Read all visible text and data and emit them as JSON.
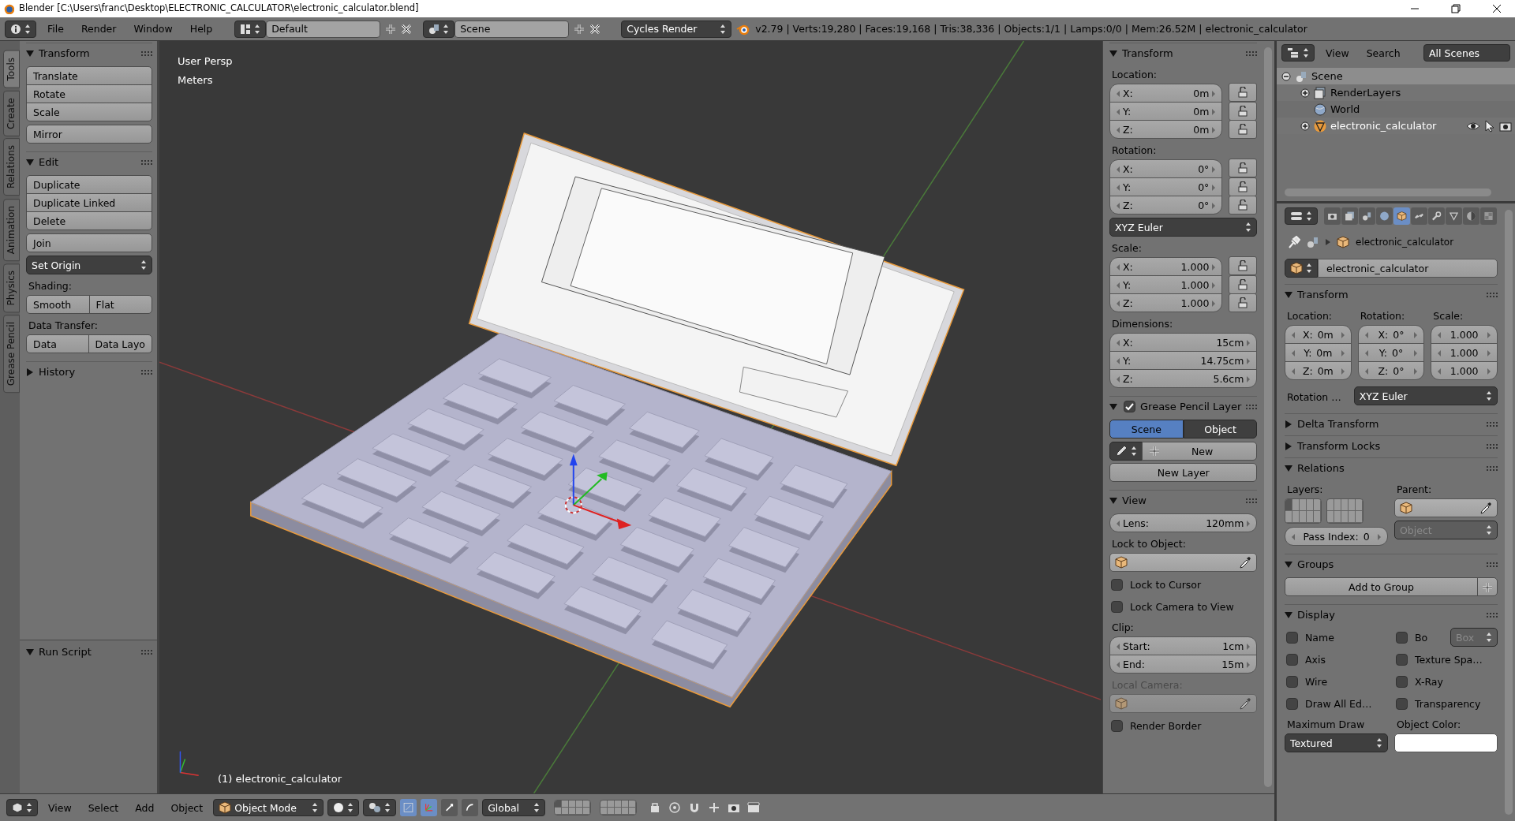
{
  "title_bar": {
    "title": "Blender  [C:\\Users\\franc\\Desktop\\ELECTRONIC_CALCULATOR\\electronic_calculator.blend]"
  },
  "info_header": {
    "menus": [
      "File",
      "Render",
      "Window",
      "Help"
    ],
    "screen_layout": "Default",
    "scene": "Scene",
    "render_engine": "Cycles Render",
    "stats": "v2.79 | Verts:19,280 | Faces:19,168 | Tris:38,336 | Objects:1/1 | Lamps:0/0 | Mem:26.52M | electronic_calculator"
  },
  "tool_tabs": [
    {
      "label": "Tools",
      "selected": true
    },
    {
      "label": "Create",
      "selected": false
    },
    {
      "label": "Relations",
      "selected": false
    },
    {
      "label": "Animation",
      "selected": false
    },
    {
      "label": "Physics",
      "selected": false
    },
    {
      "label": "Grease Pencil",
      "selected": false
    }
  ],
  "tool_shelf": {
    "panels": [
      {
        "title": "Transform",
        "expanded": true,
        "items": [
          {
            "kind": "buttons",
            "labels": [
              "Translate",
              "Rotate",
              "Scale"
            ]
          },
          {
            "kind": "buttons",
            "labels": [
              "Mirror"
            ]
          }
        ]
      },
      {
        "title": "Edit",
        "expanded": true,
        "items": [
          {
            "kind": "buttons",
            "labels": [
              "Duplicate",
              "Duplicate Linked",
              "Delete"
            ]
          },
          {
            "kind": "buttons",
            "labels": [
              "Join"
            ]
          },
          {
            "kind": "dropdown",
            "text": "Set Origin"
          },
          {
            "kind": "label",
            "text": "Shading:"
          },
          {
            "kind": "row",
            "labels": [
              "Smooth",
              "Flat"
            ]
          },
          {
            "kind": "label",
            "text": "Data Transfer:"
          },
          {
            "kind": "row",
            "labels": [
              "Data",
              "Data Layo"
            ]
          }
        ]
      },
      {
        "title": "History",
        "expanded": false
      }
    ],
    "redo_panel": {
      "title": "Run Script",
      "expanded": true
    }
  },
  "viewport": {
    "view_name": "User Persp",
    "units": "Meters",
    "object_info": "(1) electronic_calculator"
  },
  "n_panel": {
    "panels": [
      {
        "title": "Transform",
        "expanded": true,
        "items": [
          {
            "kind": "label",
            "text": "Location:"
          },
          {
            "kind": "fields",
            "rows": [
              {
                "label": "X:",
                "value": "0m",
                "locked": false
              },
              {
                "label": "Y:",
                "value": "0m",
                "locked": false
              },
              {
                "label": "Z:",
                "value": "0m",
                "locked": false
              }
            ]
          },
          {
            "kind": "label",
            "text": "Rotation:"
          },
          {
            "kind": "fields",
            "rows": [
              {
                "label": "X:",
                "value": "0°",
                "locked": false
              },
              {
                "label": "Y:",
                "value": "0°",
                "locked": false
              },
              {
                "label": "Z:",
                "value": "0°",
                "locked": false
              }
            ]
          },
          {
            "kind": "dropdown",
            "text": "XYZ Euler"
          },
          {
            "kind": "label",
            "text": "Scale:"
          },
          {
            "kind": "fields",
            "rows": [
              {
                "label": "X:",
                "value": "1.000",
                "locked": false
              },
              {
                "label": "Y:",
                "value": "1.000",
                "locked": false
              },
              {
                "label": "Z:",
                "value": "1.000",
                "locked": false
              }
            ]
          },
          {
            "kind": "label",
            "text": "Dimensions:"
          },
          {
            "kind": "fields",
            "rows": [
              {
                "label": "X:",
                "value": "15cm"
              },
              {
                "label": "Y:",
                "value": "14.75cm"
              },
              {
                "label": "Z:",
                "value": "5.6cm"
              }
            ]
          }
        ]
      },
      {
        "title": "Grease Pencil Layer",
        "expanded": true,
        "checked": true,
        "items": [
          {
            "kind": "toggle",
            "options": [
              {
                "label": "Scene",
                "selected": true
              },
              {
                "label": "Object",
                "selected": false
              }
            ]
          },
          {
            "kind": "new",
            "text": "New"
          },
          {
            "kind": "button",
            "text": "New Layer"
          }
        ]
      },
      {
        "title": "View",
        "expanded": true,
        "items": [
          {
            "kind": "fields",
            "rows": [
              {
                "label": "Lens:",
                "value": "120mm"
              }
            ]
          },
          {
            "kind": "label",
            "text": "Lock to Object:"
          },
          {
            "kind": "object_field"
          },
          {
            "kind": "checkbox",
            "label": "Lock to Cursor",
            "checked": false
          },
          {
            "kind": "checkbox",
            "label": "Lock Camera to View",
            "checked": false
          },
          {
            "kind": "label",
            "text": "Clip:"
          },
          {
            "kind": "fields",
            "rows": [
              {
                "label": "Start:",
                "value": "1cm"
              },
              {
                "label": "End:",
                "value": "15m"
              }
            ]
          },
          {
            "kind": "label",
            "text": "Local Camera:",
            "disabled": true
          },
          {
            "kind": "object_field",
            "disabled": true
          },
          {
            "kind": "checkbox",
            "label": "Render Border",
            "checked": false
          }
        ]
      }
    ]
  },
  "view_header": {
    "menus": [
      "View",
      "Select",
      "Add",
      "Object"
    ],
    "mode": "Object Mode",
    "manipulators": [
      {
        "selected": true
      },
      {
        "selected": true
      },
      {
        "selected": false
      },
      {
        "selected": false
      }
    ],
    "orientation": "Global"
  },
  "outliner": {
    "menus": [
      "View",
      "Search"
    ],
    "filter": "All Scenes",
    "tree": [
      {
        "label": "Scene",
        "kind": "scene",
        "active": true,
        "selected": false,
        "expanded": true,
        "children": [
          {
            "label": "RenderLayers",
            "kind": "render_layers",
            "active": false,
            "selected": false,
            "expanded": false
          },
          {
            "label": "World",
            "kind": "world",
            "active": false,
            "selected": false
          },
          {
            "label": "electronic_calculator",
            "kind": "mesh_object",
            "active": false,
            "selected": true,
            "expanded": false,
            "restrict": {
              "visible": true,
              "selectable": true,
              "renderable": true
            }
          }
        ]
      }
    ]
  },
  "properties": {
    "context_tabs": [
      {
        "selected": false
      },
      {
        "selected": false
      },
      {
        "selected": false
      },
      {
        "selected": false
      },
      {
        "selected": true
      },
      {
        "selected": false
      },
      {
        "selected": false
      },
      {
        "selected": false
      },
      {
        "selected": false
      },
      {
        "selected": false
      }
    ],
    "breadcrumb": "electronic_calculator",
    "object_name": "electronic_calculator",
    "panels": [
      {
        "title": "Transform",
        "expanded": true,
        "items": [
          {
            "kind": "columns",
            "columns": [
              [
                {
                  "kind": "label",
                  "text": "Location:"
                },
                {
                  "kind": "centered_fields",
                  "rows": [
                    {
                      "label": "X:",
                      "value": "0m"
                    },
                    {
                      "label": "Y:",
                      "value": "0m"
                    },
                    {
                      "label": "Z:",
                      "value": "0m"
                    }
                  ]
                }
              ],
              [
                {
                  "kind": "label",
                  "text": "Rotation:"
                },
                {
                  "kind": "centered_fields",
                  "rows": [
                    {
                      "label": "X:",
                      "value": "0°"
                    },
                    {
                      "label": "Y:",
                      "value": "0°"
                    },
                    {
                      "label": "Z:",
                      "value": "0°"
                    }
                  ]
                }
              ],
              [
                {
                  "kind": "label",
                  "text": "Scale:"
                },
                {
                  "kind": "centered_fields",
                  "rows": [
                    {
                      "value": "1.000"
                    },
                    {
                      "value": "1.000"
                    },
                    {
                      "value": "1.000"
                    }
                  ]
                }
              ]
            ]
          },
          {
            "kind": "prop_dropdown",
            "label": "Rotation …",
            "text": "XYZ Euler"
          }
        ]
      },
      {
        "title": "Delta Transform",
        "expanded": false
      },
      {
        "title": "Transform Locks",
        "expanded": false
      },
      {
        "title": "Relations",
        "expanded": true,
        "items": [
          {
            "kind": "columns",
            "columns": [
              [
                {
                  "kind": "label",
                  "text": "Layers:"
                },
                {
                  "kind": "layers"
                },
                {
                  "kind": "centered_fields",
                  "rows": [
                    {
                      "label": "Pass Index:",
                      "value": "0"
                    }
                  ]
                }
              ],
              [
                {
                  "kind": "label",
                  "text": "Parent:"
                },
                {
                  "kind": "object_field"
                },
                {
                  "kind": "dropdown",
                  "text": "Object",
                  "disabled": true
                }
              ]
            ]
          }
        ]
      },
      {
        "title": "Groups",
        "expanded": true,
        "items": [
          {
            "kind": "add_button",
            "text": "Add to Group"
          }
        ]
      },
      {
        "title": "Display",
        "expanded": true,
        "items": [
          {
            "kind": "columns",
            "columns": [
              [
                {
                  "kind": "checkbox",
                  "label": "Name",
                  "checked": false
                },
                {
                  "kind": "checkbox",
                  "label": "Axis",
                  "checked": false
                },
                {
                  "kind": "checkbox",
                  "label": "Wire",
                  "checked": false
                },
                {
                  "kind": "checkbox",
                  "label": "Draw All Ed…",
                  "checked": false
                },
                {
                  "kind": "label",
                  "text": "Maximum Draw"
                },
                {
                  "kind": "dropdown",
                  "text": "Textured"
                }
              ],
              [
                {
                  "kind": "checkbox",
                  "label": "Bo",
                  "checked": false,
                  "dropdown": "Box"
                },
                {
                  "kind": "checkbox",
                  "label": "Texture Spa…",
                  "checked": false
                },
                {
                  "kind": "checkbox",
                  "label": "X-Ray",
                  "checked": false
                },
                {
                  "kind": "checkbox",
                  "label": "Transparency",
                  "checked": false
                },
                {
                  "kind": "label",
                  "text": "Object Color:"
                },
                {
                  "kind": "color_field"
                }
              ]
            ]
          }
        ]
      }
    ]
  }
}
